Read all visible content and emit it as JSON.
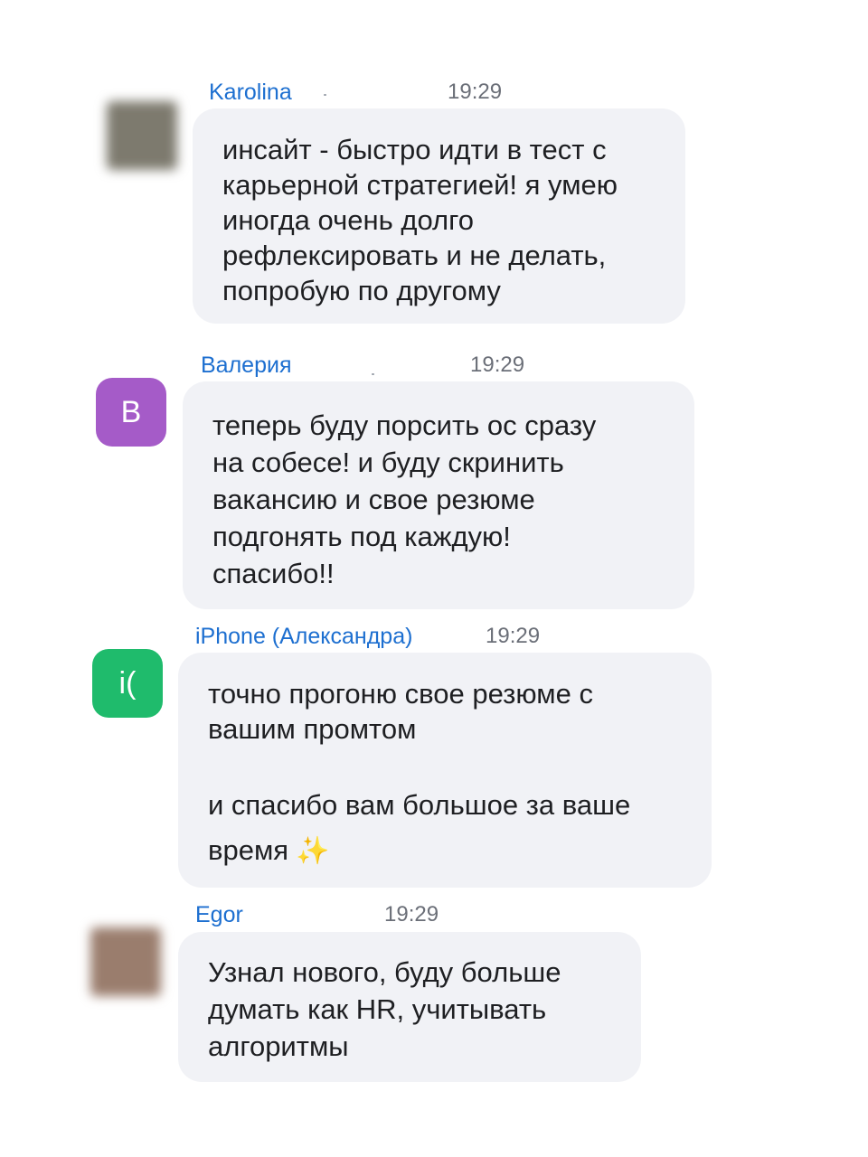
{
  "messages": [
    {
      "sender": "Karolina",
      "time": "19:29",
      "avatar": {
        "type": "photo",
        "color": "#7d7a6e",
        "initial": ""
      },
      "paragraphs": [
        "инсайт - быстро идти в тест с\nкарьерной стратегией! я умею\nиногда очень долго\nрефлексировать и не делать,\nпопробую по другому"
      ]
    },
    {
      "sender": "Валерия",
      "time": "19:29",
      "avatar": {
        "type": "initial",
        "color": "#a55bc8",
        "initial": "В"
      },
      "paragraphs": [
        "теперь буду порсить ос сразу\nна собесе! и буду скринить\nвакансию и свое резюме\nподгонять под каждую!\nспасибо!!"
      ]
    },
    {
      "sender": "iPhone (Александра)",
      "time": "19:29",
      "avatar": {
        "type": "initial",
        "color": "#1fbb6c",
        "initial": "i("
      },
      "paragraphs": [
        "точно прогоню свое резюме с\nвашим промтом",
        "и спасибо вам большое за ваше\nвремя"
      ],
      "trailing_emoji": "✨"
    },
    {
      "sender": "Egor",
      "time": "19:29",
      "avatar": {
        "type": "photo",
        "color": "#9a7d6d",
        "initial": ""
      },
      "paragraphs": [
        "Узнал нового, буду больше\nдумать как HR, учитывать\nалгоритмы"
      ]
    }
  ]
}
